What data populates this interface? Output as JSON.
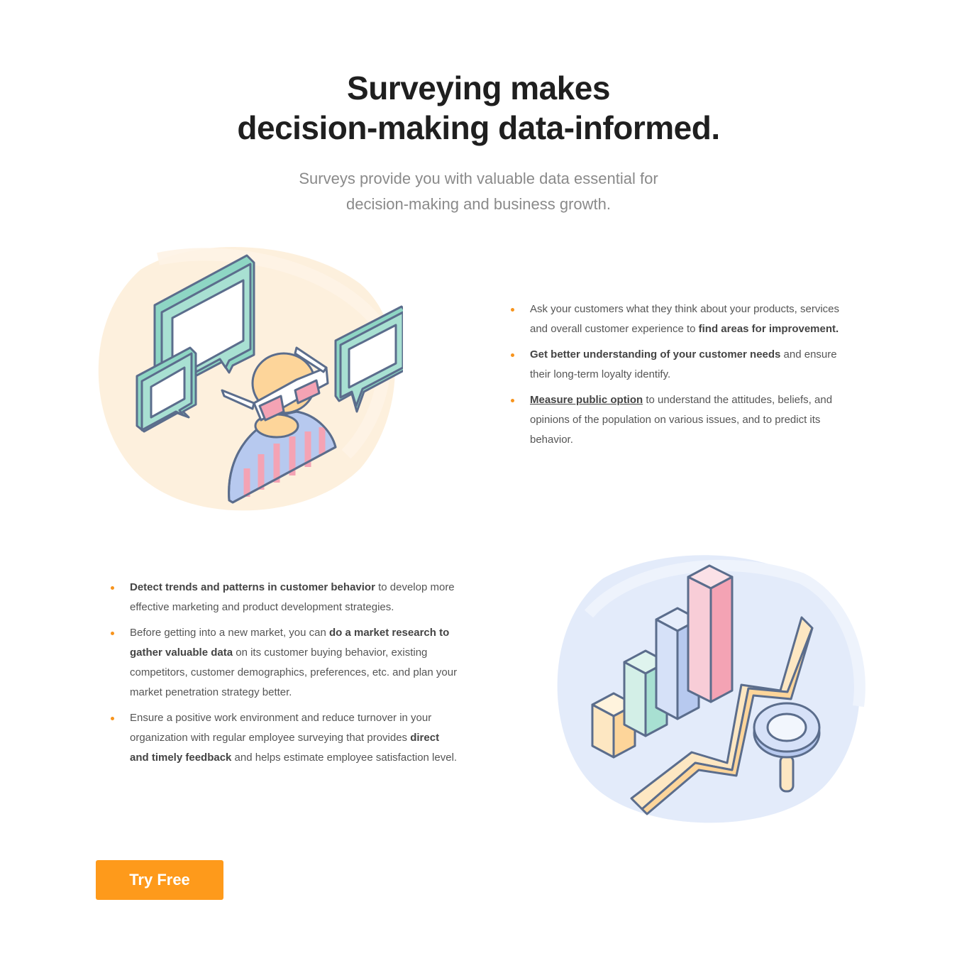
{
  "hero": {
    "title_line1": "Surveying makes",
    "title_line2": "decision-making data-informed.",
    "subtitle_line1": "Surveys provide you with valuable data essential for",
    "subtitle_line2": "decision-making and business growth."
  },
  "section1": {
    "items": [
      {
        "pre": "Ask your customers what they think about your products, services and overall customer experience to ",
        "bold": "find areas for improvement.",
        "post": ""
      },
      {
        "pre": "",
        "bold": "Get better understanding of your customer needs",
        "post": " and ensure their long-term loyalty identify."
      },
      {
        "pre": "",
        "link": "Measure public option",
        "post": " to understand the attitudes, beliefs, and opinions of the population on various issues, and to predict its behavior."
      }
    ]
  },
  "section2": {
    "items": [
      {
        "pre": "",
        "bold": "Detect trends and patterns in customer behavior",
        "post": " to develop more effective marketing and product development strategies."
      },
      {
        "pre": "Before getting into a new market, you can ",
        "bold": "do a market research to gather valuable data",
        "post": " on its customer buying behavior, existing competitors, customer demographics, preferences, etc. and plan your market penetration strategy better."
      },
      {
        "pre": "Ensure a positive work environment and reduce turnover in your organization with regular employee surveying that provides ",
        "bold": "direct and timely feedback",
        "post": " and helps estimate employee satisfaction level."
      }
    ]
  },
  "cta": {
    "label": "Try Free"
  },
  "colors": {
    "accent": "#fe9a1b",
    "bullet": "#f7941d",
    "outline": "#5b6d8c",
    "mint": "#a8e0d2",
    "peach": "#fde7c2",
    "pink": "#f4a3b4",
    "blue": "#b7c9ef"
  },
  "icons": {
    "section1_illustration": "person-with-vr-glasses-and-speech-bubbles-illustration",
    "section2_illustration": "bar-chart-with-trend-arrow-and-magnifier-illustration"
  }
}
